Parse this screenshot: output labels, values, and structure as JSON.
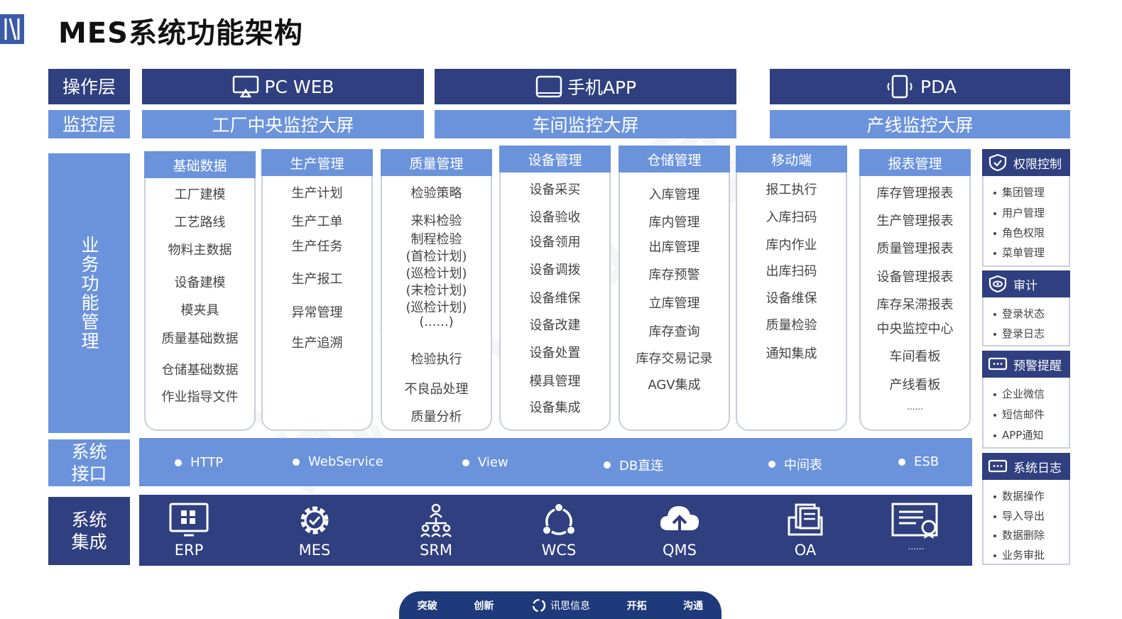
{
  "page": {
    "title": "MES系统功能架构"
  },
  "layers": {
    "operation": "操作层",
    "monitor": "监控层",
    "business": "业务功能管理",
    "interface": "系统接口",
    "integration": "系统集成"
  },
  "operation_bars": [
    "PC WEB",
    "手机APP",
    "PDA"
  ],
  "monitor_bars": [
    "工厂中央监控大屏",
    "车间监控大屏",
    "产线监控大屏"
  ],
  "modules": [
    {
      "title": "基础数据",
      "items": [
        "工厂建模",
        "工艺路线",
        "物料主数据",
        "设备建模",
        "模夹具",
        "质量基础数据",
        "仓储基础数据",
        "作业指导文件"
      ]
    },
    {
      "title": "生产管理",
      "items": [
        "生产计划",
        "生产工单",
        "生产任务",
        "生产报工",
        "异常管理",
        "生产追溯"
      ]
    },
    {
      "title": "质量管理",
      "items": [
        "检验策略",
        "来料检验",
        "制程检验",
        "(首检计划)",
        "(巡检计划)",
        "(末检计划)",
        "(巡检计划)",
        "(......)",
        "检验执行",
        "不良品处理",
        "质量分析"
      ]
    },
    {
      "title": "设备管理",
      "items": [
        "设备采买",
        "设备验收",
        "设备领用",
        "设备调拨",
        "设备维保",
        "设备改建",
        "设备处置",
        "模具管理",
        "设备集成"
      ]
    },
    {
      "title": "仓储管理",
      "items": [
        "入库管理",
        "库内管理",
        "出库管理",
        "库存预警",
        "立库管理",
        "库存查询",
        "库存交易记录",
        "AGV集成"
      ]
    },
    {
      "title": "移动端",
      "items": [
        "报工执行",
        "入库扫码",
        "库内作业",
        "出库扫码",
        "设备维保",
        "质量检验",
        "通知集成"
      ]
    },
    {
      "title": "报表管理",
      "items": [
        "库存管理报表",
        "生产管理报表",
        "质量管理报表",
        "设备管理报表",
        "库存呆滞报表",
        "中央监控中心",
        "车间看板",
        "产线看板",
        "......"
      ]
    }
  ],
  "side_panels": [
    {
      "title": "权限控制",
      "icon": "shield-check-icon",
      "items": [
        "集团管理",
        "用户管理",
        "角色权限",
        "菜单管理"
      ]
    },
    {
      "title": "审计",
      "icon": "shield-eye-icon",
      "items": [
        "登录状态",
        "登录日志"
      ]
    },
    {
      "title": "预警提醒",
      "icon": "message-icon",
      "items": [
        "企业微信",
        "短信邮件",
        "APP通知"
      ]
    },
    {
      "title": "系统日志",
      "icon": "message-icon",
      "items": [
        "数据操作",
        "导入导出",
        "数据删除",
        "业务审批"
      ]
    }
  ],
  "interfaces": [
    "HTTP",
    "WebService",
    "View",
    "DB直连",
    "中间表",
    "ESB"
  ],
  "systems": [
    {
      "label": "ERP",
      "icon": "erp-icon"
    },
    {
      "label": "MES",
      "icon": "gear-check-icon"
    },
    {
      "label": "SRM",
      "icon": "people-network-icon"
    },
    {
      "label": "WCS",
      "icon": "cycle-icon"
    },
    {
      "label": "QMS",
      "icon": "cloud-upload-icon"
    },
    {
      "label": "OA",
      "icon": "documents-icon"
    },
    {
      "label": "......",
      "icon": "certificate-icon"
    }
  ],
  "footer": {
    "items": [
      "突破",
      "创新",
      "讯思信息",
      "开拓",
      "沟通"
    ]
  },
  "colors": {
    "dark": "#2f3f7f",
    "light": "#6b93dc",
    "footer": "#1f3a7a"
  }
}
